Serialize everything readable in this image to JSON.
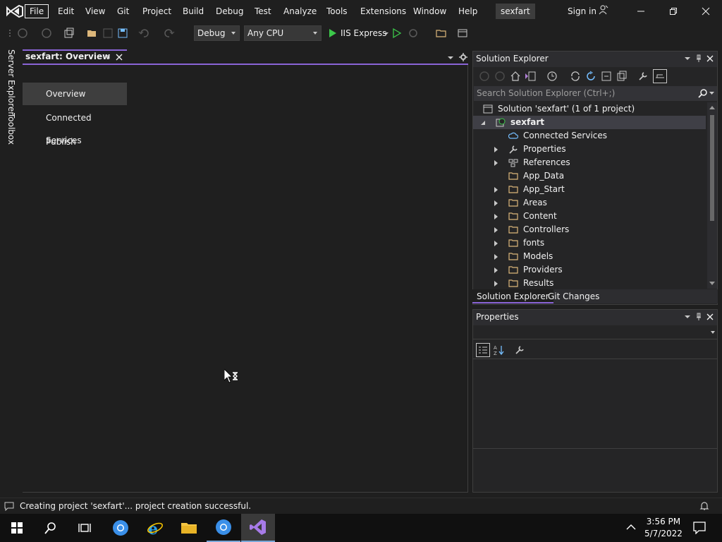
{
  "menu": {
    "items": [
      "File",
      "Edit",
      "View",
      "Git",
      "Project",
      "Build",
      "Debug",
      "Test",
      "Analyze",
      "Tools",
      "Extensions",
      "Window",
      "Help"
    ],
    "solution_badge": "sexfart",
    "sign_in": "Sign in"
  },
  "toolbar": {
    "configuration": "Debug",
    "platform": "Any CPU",
    "run_target": "IIS Express"
  },
  "left_strip": {
    "server_explorer": "Server Explorer",
    "toolbox": "Toolbox"
  },
  "document": {
    "tab_title": "sexfart: Overview",
    "nav": [
      "Overview",
      "Connected Services",
      "Publish"
    ]
  },
  "solution_explorer": {
    "title": "Solution Explorer",
    "search_placeholder": "Search Solution Explorer (Ctrl+;)",
    "solution_label": "Solution 'sexfart' (1 of 1 project)",
    "project": "sexfart",
    "items": [
      {
        "label": "Connected Services",
        "expandable": false,
        "icon": "cloud-icon"
      },
      {
        "label": "Properties",
        "expandable": true,
        "icon": "wrench-icon"
      },
      {
        "label": "References",
        "expandable": true,
        "icon": "references-icon"
      },
      {
        "label": "App_Data",
        "expandable": false,
        "icon": "folder-icon"
      },
      {
        "label": "App_Start",
        "expandable": true,
        "icon": "folder-icon"
      },
      {
        "label": "Areas",
        "expandable": true,
        "icon": "folder-icon"
      },
      {
        "label": "Content",
        "expandable": true,
        "icon": "folder-icon"
      },
      {
        "label": "Controllers",
        "expandable": true,
        "icon": "folder-icon"
      },
      {
        "label": "fonts",
        "expandable": true,
        "icon": "folder-icon"
      },
      {
        "label": "Models",
        "expandable": true,
        "icon": "folder-icon"
      },
      {
        "label": "Providers",
        "expandable": true,
        "icon": "folder-icon"
      },
      {
        "label": "Results",
        "expandable": true,
        "icon": "folder-icon"
      }
    ],
    "tabs": [
      "Solution Explorer",
      "Git Changes"
    ]
  },
  "properties": {
    "title": "Properties"
  },
  "status": {
    "message": "Creating project 'sexfart'... project creation successful."
  },
  "taskbar": {
    "time": "3:56 PM",
    "date": "5/7/2022"
  },
  "colors": {
    "accent": "#8a64d6",
    "background": "#1f1f1f",
    "panel": "#252526"
  }
}
